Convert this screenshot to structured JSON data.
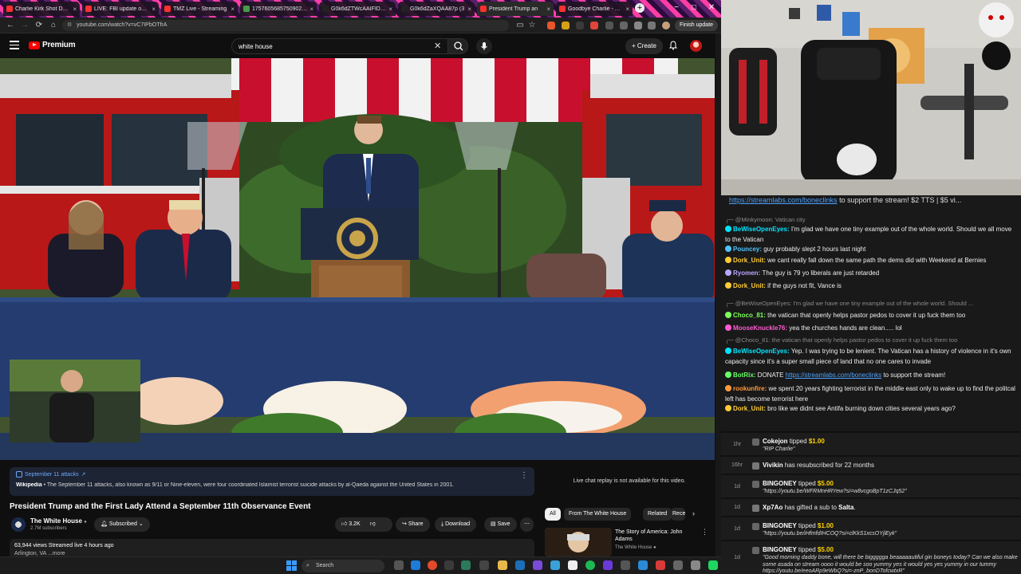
{
  "browser": {
    "tabs": [
      {
        "title": "Charlie Kirk Shot Dead",
        "color": "#ff3030"
      },
      {
        "title": "LIVE: FBI update on Ch",
        "color": "#ff3030"
      },
      {
        "title": "TMZ Live - Streaming",
        "color": "#ff3030"
      },
      {
        "title": "1757605685750902.jp",
        "color": "#4a9a4a"
      },
      {
        "title": "G0k6dZTWcAAIFID (3",
        "color": "#222222"
      },
      {
        "title": "G0k6dZaXQAA87p (3",
        "color": "#222222"
      },
      {
        "title": "President Trump an",
        "color": "#ff3030"
      },
      {
        "title": "Goodbye Charlie - You",
        "color": "#ff3030"
      }
    ],
    "url": "youtube.com/watch?v=vC7IPbOTfrA",
    "finish_update": "Finish update"
  },
  "youtube": {
    "logo_text": "Premium",
    "search_value": "white house",
    "create_label": "Create",
    "info_card": {
      "topic": "September 11 attacks",
      "source": "Wikipedia",
      "text": " • The September 11 attacks, also known as 9/11 or Nine-eleven, were four coordinated Islamist terrorist suicide attacks by al-Qaeda against the United States in 2001."
    },
    "video_title": "President Trump and the First Lady Attend a September 11th Observance Event",
    "channel": {
      "name": "The White House",
      "subs": "2.7M subscribers",
      "subscribed_label": "Subscribed"
    },
    "actions": {
      "likes": "3.2K",
      "share": "Share",
      "download": "Download",
      "save": "Save"
    },
    "views_line": "63,944 views  Streamed live 4 hours ago",
    "views_sub": "Arlington, VA ...more",
    "replay_note": "Live chat replay is not available for this video.",
    "chips": [
      "All",
      "From The White House",
      "Related",
      "Rece"
    ],
    "recommendation": {
      "title": "The Story of America: John Adams",
      "channel": "The White House"
    }
  },
  "chat": {
    "top_link": "https://streamlabs.com/boneclinks",
    "top_suffix": " to support the stream! $2 TTS | $5 vi...",
    "messages": [
      {
        "type": "reply",
        "text": "@Minkymoon: Vatican city"
      },
      {
        "type": "msg",
        "user": "BeWiseOpenEyes",
        "color": "#00e5ff",
        "text": "I'm glad we have one tiny example out of the whole world. Should we all move to the Vatican"
      },
      {
        "type": "msg",
        "user": "Pouncey",
        "color": "#4fc3ff",
        "text": "guy probably slept 2 hours last night"
      },
      {
        "type": "msg",
        "user": "Dork_Unit",
        "color": "#ffcc33",
        "text": "we cant really fall down the same path the dems did with Weekend at Bernies"
      },
      {
        "type": "msg",
        "user": "Ryomen",
        "color": "#b9a6ff",
        "text": "The guy is 79 yo liberals are just retarded"
      },
      {
        "type": "msg",
        "user": "Dork_Unit",
        "color": "#ffcc33",
        "text": "if the guys not fit, Vance is"
      },
      {
        "type": "reply",
        "text": "@BeWiseOpenEyes: I'm glad we have one tiny example out of the whole world. Should ..."
      },
      {
        "type": "msg",
        "user": "Choco_81",
        "color": "#7cff5a",
        "text": "the vatican that openly helps pastor pedos to cover it up fuck them too"
      },
      {
        "type": "msg",
        "user": "MooseKnuckle76",
        "color": "#ff5ad1",
        "text": "yea the churches hands are clean..... lol"
      },
      {
        "type": "reply",
        "text": "@Choco_81: the vatican that openly helps pastor pedos to cover it up fuck them too"
      },
      {
        "type": "msg",
        "user": "BeWiseOpenEyes",
        "color": "#00e5ff",
        "text": "Yep. I was trying to be lenient. The Vatican has a history of violence in it's own capacity since it's a super small piece of land that no one cares to invade"
      },
      {
        "type": "bot",
        "user": "BotRix",
        "color": "#66ff66",
        "pre": "DONATE ",
        "link": "https://streamlabs.com/boneclinks",
        "post": " to support the stream!"
      },
      {
        "type": "msg",
        "user": "rookunfire",
        "color": "#ff9a3c",
        "text": "we spent 20 years fighting terrorist in the middle east only to wake up to find the politcal left has become terrorist here"
      },
      {
        "type": "msg",
        "user": "Dork_Unit",
        "color": "#ffcc33",
        "text": "bro like we didnt see Antifa burning down cities several years ago?"
      }
    ]
  },
  "feed": [
    {
      "time": "1hr",
      "user": "Cokejon",
      "action": " tipped ",
      "amount": "$1.00",
      "sub": "\"RIP Charlie\"",
      "icon": "#666666"
    },
    {
      "time": "16hr",
      "user": "Vivikin",
      "action": " has resubscribed for 22 months",
      "amount": "",
      "sub": "",
      "icon": "#777777"
    },
    {
      "time": "1d",
      "user": "BINGONEY",
      "action": " tipped ",
      "amount": "$5.00",
      "sub": "\"https://youtu.be/WFRMnHRYew?si=w8vcgoBpT1zCJq52\"",
      "icon": "#666666"
    },
    {
      "time": "1d",
      "user": "Xp7Ao",
      "action": " has gifted a sub to ",
      "amount": "",
      "target": "Salta",
      "sub": "",
      "icon": "#777777"
    },
    {
      "time": "1d",
      "user": "BINGONEY",
      "action": " tipped ",
      "amount": "$1.00",
      "sub": "\"https://youtu.be/iHfmfdIHCOQ?si=clKkS1xcsOYjlEyk\"",
      "icon": "#666666"
    },
    {
      "time": "1d",
      "user": "BINGONEY",
      "action": " tipped ",
      "amount": "$5.00",
      "sub": "\"Good morning daddy bone, will there be biggggga beaaaaautiful gin boneys today? Can we also make some asada on stream oooo it would be soo yummy yes it would yes yes yummy in our tummy https://youtu.be/eeoARp9eWbQ?si=-znP_bonDTofcwtxR\"",
      "icon": "#666666"
    }
  ],
  "taskbar": {
    "search": "Search"
  }
}
